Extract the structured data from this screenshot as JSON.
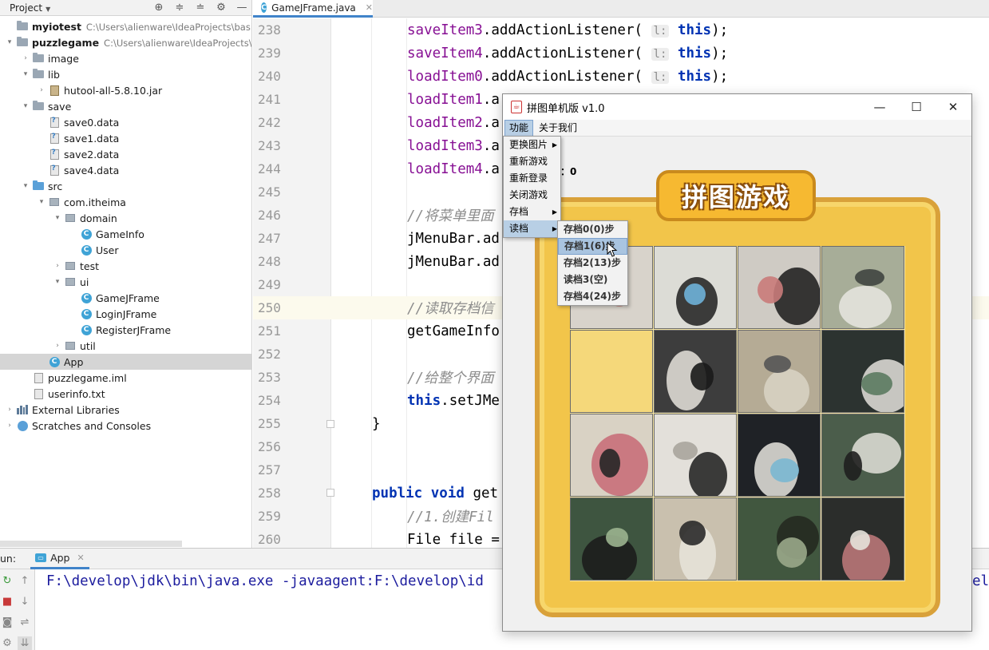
{
  "project_panel": {
    "title": "Project",
    "items": [
      {
        "name": "myiotest",
        "path": "C:\\Users\\alienware\\IdeaProjects\\basic-c",
        "depth": 0,
        "icon": "project-folder-icon",
        "chevron": "",
        "bold": true
      },
      {
        "name": "puzzlegame",
        "path": "C:\\Users\\alienware\\IdeaProjects\\bas",
        "depth": 0,
        "icon": "project-folder-icon",
        "chevron": "▾",
        "bold": true
      },
      {
        "name": "image",
        "path": "",
        "depth": 1,
        "icon": "folder-icon",
        "chevron": "›"
      },
      {
        "name": "lib",
        "path": "",
        "depth": 1,
        "icon": "folder-icon",
        "chevron": "▾"
      },
      {
        "name": "hutool-all-5.8.10.jar",
        "path": "",
        "depth": 2,
        "icon": "jar-icon",
        "chevron": "›"
      },
      {
        "name": "save",
        "path": "",
        "depth": 1,
        "icon": "folder-icon",
        "chevron": "▾"
      },
      {
        "name": "save0.data",
        "path": "",
        "depth": 2,
        "icon": "unknown-file-icon",
        "chevron": ""
      },
      {
        "name": "save1.data",
        "path": "",
        "depth": 2,
        "icon": "unknown-file-icon",
        "chevron": ""
      },
      {
        "name": "save2.data",
        "path": "",
        "depth": 2,
        "icon": "unknown-file-icon",
        "chevron": ""
      },
      {
        "name": "save4.data",
        "path": "",
        "depth": 2,
        "icon": "unknown-file-icon",
        "chevron": ""
      },
      {
        "name": "src",
        "path": "",
        "depth": 1,
        "icon": "source-folder-icon",
        "chevron": "▾"
      },
      {
        "name": "com.itheima",
        "path": "",
        "depth": 2,
        "icon": "package-icon",
        "chevron": "▾"
      },
      {
        "name": "domain",
        "path": "",
        "depth": 3,
        "icon": "package-icon",
        "chevron": "▾"
      },
      {
        "name": "GameInfo",
        "path": "",
        "depth": 4,
        "icon": "class-icon",
        "chevron": ""
      },
      {
        "name": "User",
        "path": "",
        "depth": 4,
        "icon": "class-icon",
        "chevron": ""
      },
      {
        "name": "test",
        "path": "",
        "depth": 3,
        "icon": "package-icon",
        "chevron": "›"
      },
      {
        "name": "ui",
        "path": "",
        "depth": 3,
        "icon": "package-icon",
        "chevron": "▾"
      },
      {
        "name": "GameJFrame",
        "path": "",
        "depth": 4,
        "icon": "class-icon",
        "chevron": ""
      },
      {
        "name": "LoginJFrame",
        "path": "",
        "depth": 4,
        "icon": "class-icon",
        "chevron": ""
      },
      {
        "name": "RegisterJFrame",
        "path": "",
        "depth": 4,
        "icon": "class-icon",
        "chevron": ""
      },
      {
        "name": "util",
        "path": "",
        "depth": 3,
        "icon": "package-icon",
        "chevron": "›"
      },
      {
        "name": "App",
        "path": "",
        "depth": 2,
        "icon": "class-icon",
        "chevron": "",
        "selected": true
      },
      {
        "name": "puzzlegame.iml",
        "path": "",
        "depth": 1,
        "icon": "file-icon",
        "chevron": ""
      },
      {
        "name": "userinfo.txt",
        "path": "",
        "depth": 1,
        "icon": "file-icon",
        "chevron": ""
      },
      {
        "name": "External Libraries",
        "path": "",
        "depth": 0,
        "icon": "libraries-icon",
        "chevron": "›"
      },
      {
        "name": "Scratches and Consoles",
        "path": "",
        "depth": 0,
        "icon": "scratches-icon",
        "chevron": "›"
      }
    ]
  },
  "editor": {
    "tab_label": "GameJFrame.java",
    "lines": [
      {
        "num": "238",
        "indent": 2,
        "tokens": [
          {
            "t": "saveItem3",
            "c": "field"
          },
          {
            "t": ".addActionListener( ",
            "c": ""
          },
          {
            "t": "l:",
            "c": "hint"
          },
          {
            "t": " this",
            "c": "kw"
          },
          {
            "t": ");",
            "c": ""
          }
        ]
      },
      {
        "num": "239",
        "indent": 2,
        "tokens": [
          {
            "t": "saveItem4",
            "c": "field"
          },
          {
            "t": ".addActionListener( ",
            "c": ""
          },
          {
            "t": "l:",
            "c": "hint"
          },
          {
            "t": " this",
            "c": "kw"
          },
          {
            "t": ");",
            "c": ""
          }
        ]
      },
      {
        "num": "240",
        "indent": 2,
        "tokens": [
          {
            "t": "loadItem0",
            "c": "field"
          },
          {
            "t": ".addActionListener( ",
            "c": ""
          },
          {
            "t": "l:",
            "c": "hint"
          },
          {
            "t": " this",
            "c": "kw"
          },
          {
            "t": ");",
            "c": ""
          }
        ]
      },
      {
        "num": "241",
        "indent": 2,
        "tokens": [
          {
            "t": "loadItem1",
            "c": "field"
          },
          {
            "t": ".a",
            "c": ""
          }
        ]
      },
      {
        "num": "242",
        "indent": 2,
        "tokens": [
          {
            "t": "loadItem2",
            "c": "field"
          },
          {
            "t": ".a",
            "c": ""
          }
        ]
      },
      {
        "num": "243",
        "indent": 2,
        "tokens": [
          {
            "t": "loadItem3",
            "c": "field"
          },
          {
            "t": ".a",
            "c": ""
          }
        ]
      },
      {
        "num": "244",
        "indent": 2,
        "tokens": [
          {
            "t": "loadItem4",
            "c": "field"
          },
          {
            "t": ".a",
            "c": ""
          }
        ]
      },
      {
        "num": "245",
        "indent": 2,
        "tokens": []
      },
      {
        "num": "246",
        "indent": 2,
        "tokens": [
          {
            "t": "//将菜单里面",
            "c": "comment"
          }
        ]
      },
      {
        "num": "247",
        "indent": 2,
        "tokens": [
          {
            "t": "jMenuBar.ad",
            "c": ""
          }
        ]
      },
      {
        "num": "248",
        "indent": 2,
        "tokens": [
          {
            "t": "jMenuBar.ad",
            "c": ""
          }
        ]
      },
      {
        "num": "249",
        "indent": 2,
        "tokens": []
      },
      {
        "num": "250",
        "indent": 2,
        "tokens": [
          {
            "t": "//读取存档信",
            "c": "comment"
          }
        ],
        "current": true
      },
      {
        "num": "251",
        "indent": 2,
        "tokens": [
          {
            "t": "getGameInfo",
            "c": ""
          }
        ]
      },
      {
        "num": "252",
        "indent": 2,
        "tokens": []
      },
      {
        "num": "253",
        "indent": 2,
        "tokens": [
          {
            "t": "//给整个界面",
            "c": "comment"
          }
        ]
      },
      {
        "num": "254",
        "indent": 2,
        "tokens": [
          {
            "t": "this",
            "c": "kw"
          },
          {
            "t": ".setJMe",
            "c": ""
          }
        ]
      },
      {
        "num": "255",
        "indent": 1,
        "tokens": [
          {
            "t": "}",
            "c": ""
          }
        ]
      },
      {
        "num": "256",
        "indent": 1,
        "tokens": []
      },
      {
        "num": "257",
        "indent": 1,
        "tokens": []
      },
      {
        "num": "258",
        "indent": 1,
        "tokens": [
          {
            "t": "public void",
            "c": "kw"
          },
          {
            "t": " get",
            "c": ""
          }
        ]
      },
      {
        "num": "259",
        "indent": 2,
        "tokens": [
          {
            "t": "//1.创建Fil",
            "c": "comment"
          }
        ]
      },
      {
        "num": "260",
        "indent": 2,
        "tokens": [
          {
            "t": "File file =",
            "c": ""
          }
        ]
      }
    ]
  },
  "run_panel": {
    "label": "un:",
    "tab_label": "App",
    "console_text": "F:\\develop\\jdk\\bin\\java.exe -javaagent:F:\\develop\\id",
    "console_tail": "ell"
  },
  "game_window": {
    "title": "拼图单机版 v1.0",
    "minimize": "—",
    "maximize": "☐",
    "close": "✕",
    "menu": [
      {
        "label": "功能",
        "active": true
      },
      {
        "label": "关于我们",
        "active": false
      }
    ],
    "steps_text": "：0",
    "banner_text": "拼图游戏",
    "function_menu": [
      {
        "label": "更换图片",
        "submenu": true,
        "highlighted": false
      },
      {
        "label": "重新游戏",
        "submenu": false,
        "highlighted": false
      },
      {
        "label": "重新登录",
        "submenu": false,
        "highlighted": false
      },
      {
        "label": "关闭游戏",
        "submenu": false,
        "highlighted": false
      },
      {
        "label": "存档",
        "submenu": true,
        "highlighted": false
      },
      {
        "label": "读档",
        "submenu": true,
        "highlighted": true
      }
    ],
    "load_menu": [
      {
        "label": "存档0(0)步",
        "highlighted": false
      },
      {
        "label": "存档1(6)步",
        "highlighted": true
      },
      {
        "label": "存档2(13)步",
        "highlighted": false
      },
      {
        "label": "读档3(空)",
        "highlighted": false
      },
      {
        "label": "存档4(24)步",
        "highlighted": false
      }
    ],
    "tiles": [
      {
        "id": "1",
        "base": "#d8d3cb",
        "accent": "#2b2b2b",
        "accent2": "#c98c86"
      },
      {
        "id": "2",
        "base": "#dcdcd6",
        "accent": "#1f1f1f",
        "accent2": "#6fb3d9"
      },
      {
        "id": "3",
        "base": "#cfcbc4",
        "accent": "#1a1a1a",
        "accent2": "#c97b7a"
      },
      {
        "id": "4",
        "base": "#a7ad98",
        "accent": "#e8e6e0",
        "accent2": "#404540"
      },
      {
        "id": "blank",
        "base": "#f5d87a",
        "accent": "#f5d87a",
        "accent2": "#f5d87a"
      },
      {
        "id": "6",
        "base": "#3d3d3d",
        "accent": "#e6e3dc",
        "accent2": "#1a1a1a"
      },
      {
        "id": "7",
        "base": "#b5ab95",
        "accent": "#d9d3c6",
        "accent2": "#555"
      },
      {
        "id": "8",
        "base": "#2c3330",
        "accent": "#e3e1da",
        "accent2": "#5b7a60"
      },
      {
        "id": "9",
        "base": "#d9d2c4",
        "accent": "#c76a76",
        "accent2": "#262626"
      },
      {
        "id": "10",
        "base": "#e3e0da",
        "accent": "#1c1c1c",
        "accent2": "#a9a59c"
      },
      {
        "id": "11",
        "base": "#1f2226",
        "accent": "#e6e4de",
        "accent2": "#7ab7d2"
      },
      {
        "id": "12",
        "base": "#4b5d4b",
        "accent": "#e2e0d9",
        "accent2": "#1f1f1f"
      },
      {
        "id": "13",
        "base": "#3e5540",
        "accent": "#1a1a1a",
        "accent2": "#9bb48f"
      },
      {
        "id": "14",
        "base": "#c9c0ae",
        "accent": "#e8e4da",
        "accent2": "#2a2a2a"
      },
      {
        "id": "15",
        "base": "#41573f",
        "accent": "#23271f",
        "accent2": "#9aa98a"
      },
      {
        "id": "16",
        "base": "#2b2d2b",
        "accent": "#c27b7c",
        "accent2": "#e5e2da"
      }
    ]
  }
}
